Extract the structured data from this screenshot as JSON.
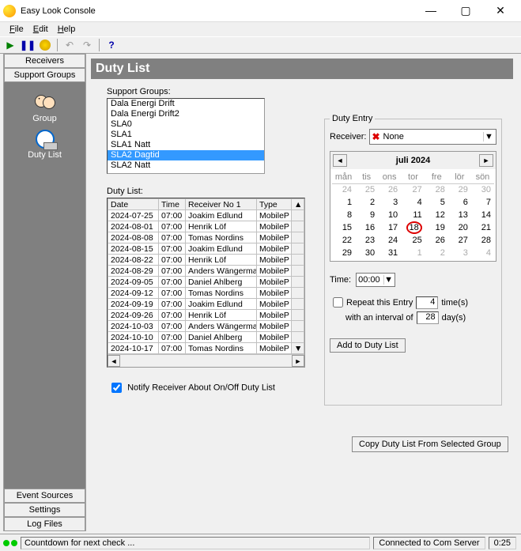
{
  "window": {
    "title": "Easy Look Console"
  },
  "menu": {
    "file": "File",
    "edit": "Edit",
    "help": "Help"
  },
  "sidebar": {
    "tabs": {
      "receivers": "Receivers",
      "support_groups": "Support Groups"
    },
    "icons": {
      "group": "Group",
      "duty_list": "Duty List"
    },
    "buttons": {
      "event_sources": "Event Sources",
      "settings": "Settings",
      "log_files": "Log Files"
    }
  },
  "content": {
    "heading": "Duty List",
    "support_groups_label": "Support Groups:",
    "support_groups": [
      "Dala Energi Drift",
      "Dala Energi Drift2",
      "SLA0",
      "SLA1",
      "SLA1 Natt",
      "SLA2 Dagtid",
      "SLA2 Natt"
    ],
    "selected_group_index": 5,
    "duty_list_label": "Duty List:",
    "columns": [
      "Date",
      "Time",
      "Receiver No 1",
      "Type"
    ],
    "rows": [
      {
        "date": "2024-07-25",
        "time": "07:00",
        "receiver": "Joakim Edlund",
        "type": "MobileP"
      },
      {
        "date": "2024-08-01",
        "time": "07:00",
        "receiver": "Henrik Löf",
        "type": "MobileP"
      },
      {
        "date": "2024-08-08",
        "time": "07:00",
        "receiver": "Tomas Nordins",
        "type": "MobileP"
      },
      {
        "date": "2024-08-15",
        "time": "07:00",
        "receiver": "Joakim Edlund",
        "type": "MobileP"
      },
      {
        "date": "2024-08-22",
        "time": "07:00",
        "receiver": "Henrik Löf",
        "type": "MobileP"
      },
      {
        "date": "2024-08-29",
        "time": "07:00",
        "receiver": "Anders Wängermark",
        "type": "MobileP"
      },
      {
        "date": "2024-09-05",
        "time": "07:00",
        "receiver": "Daniel Ahlberg",
        "type": "MobileP"
      },
      {
        "date": "2024-09-12",
        "time": "07:00",
        "receiver": "Tomas Nordins",
        "type": "MobileP"
      },
      {
        "date": "2024-09-19",
        "time": "07:00",
        "receiver": "Joakim Edlund",
        "type": "MobileP"
      },
      {
        "date": "2024-09-26",
        "time": "07:00",
        "receiver": "Henrik Löf",
        "type": "MobileP"
      },
      {
        "date": "2024-10-03",
        "time": "07:00",
        "receiver": "Anders Wängermark",
        "type": "MobileP"
      },
      {
        "date": "2024-10-10",
        "time": "07:00",
        "receiver": "Daniel Ahlberg",
        "type": "MobileP"
      },
      {
        "date": "2024-10-17",
        "time": "07:00",
        "receiver": "Tomas Nordins",
        "type": "MobileP"
      }
    ],
    "notify_label": "Notify Receiver About On/Off Duty List",
    "notify_checked": true
  },
  "duty_entry": {
    "legend": "Duty Entry",
    "receiver_label": "Receiver:",
    "receiver_value": "None",
    "month_label": "juli 2024",
    "weekdays": [
      "mån",
      "tis",
      "ons",
      "tor",
      "fre",
      "lör",
      "sön"
    ],
    "weeks": [
      [
        {
          "d": 24,
          "o": true
        },
        {
          "d": 25,
          "o": true
        },
        {
          "d": 26,
          "o": true
        },
        {
          "d": 27,
          "o": true
        },
        {
          "d": 28,
          "o": true
        },
        {
          "d": 29,
          "o": true
        },
        {
          "d": 30,
          "o": true
        }
      ],
      [
        {
          "d": 1
        },
        {
          "d": 2
        },
        {
          "d": 3
        },
        {
          "d": 4
        },
        {
          "d": 5
        },
        {
          "d": 6
        },
        {
          "d": 7
        }
      ],
      [
        {
          "d": 8
        },
        {
          "d": 9
        },
        {
          "d": 10
        },
        {
          "d": 11
        },
        {
          "d": 12
        },
        {
          "d": 13
        },
        {
          "d": 14
        }
      ],
      [
        {
          "d": 15
        },
        {
          "d": 16
        },
        {
          "d": 17
        },
        {
          "d": 18,
          "today": true
        },
        {
          "d": 19
        },
        {
          "d": 20
        },
        {
          "d": 21
        }
      ],
      [
        {
          "d": 22
        },
        {
          "d": 23
        },
        {
          "d": 24
        },
        {
          "d": 25
        },
        {
          "d": 26
        },
        {
          "d": 27
        },
        {
          "d": 28
        }
      ],
      [
        {
          "d": 29
        },
        {
          "d": 30
        },
        {
          "d": 31
        },
        {
          "d": 1,
          "o": true
        },
        {
          "d": 2,
          "o": true
        },
        {
          "d": 3,
          "o": true
        },
        {
          "d": 4,
          "o": true
        }
      ]
    ],
    "time_label": "Time:",
    "time_value": "00:00",
    "repeat_label": "Repeat this Entry",
    "repeat_times": "4",
    "repeat_suffix": "time(s)",
    "interval_prefix": "with an interval of",
    "interval_days": "28",
    "interval_suffix": "day(s)",
    "add_button": "Add to Duty List"
  },
  "copy_button": "Copy Duty List From Selected Group",
  "status": {
    "countdown": "Countdown for next check ...",
    "connection": "Connected to Com Server",
    "time": "0:25"
  }
}
